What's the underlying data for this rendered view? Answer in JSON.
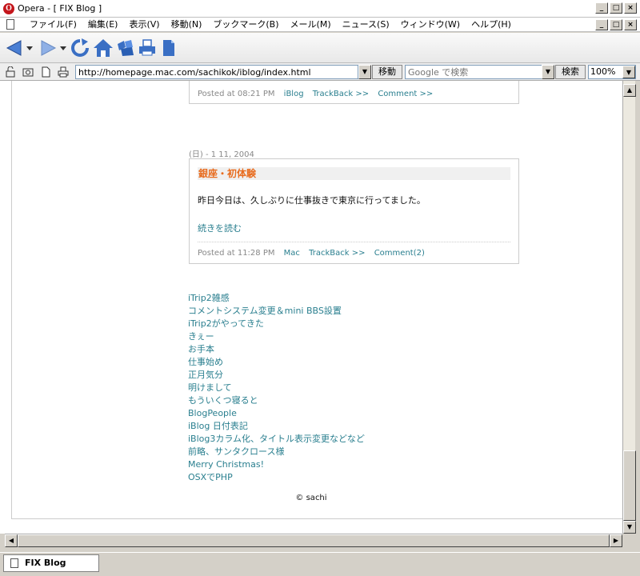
{
  "window": {
    "title": "Opera - [ FIX Blog ]",
    "controls": [
      "_",
      "□",
      "×"
    ]
  },
  "menubar": {
    "items": [
      "ファイル(F)",
      "編集(E)",
      "表示(V)",
      "移動(N)",
      "ブックマーク(B)",
      "メール(M)",
      "ニュース(S)",
      "ウィンドウ(W)",
      "ヘルプ(H)"
    ]
  },
  "toolbar": {
    "icons": [
      "back-icon",
      "back-dropdown-icon",
      "forward-icon",
      "forward-dropdown-icon",
      "reload-icon",
      "home-icon",
      "hotlist-icon",
      "print-icon",
      "page-icon"
    ]
  },
  "addressbar": {
    "url": "http://homepage.mac.com/sachikok/iblog/index.html",
    "go_label": "移動",
    "search_placeholder": "Google で検索",
    "search_label": "検索",
    "zoom": "100%"
  },
  "prev_post": {
    "posted": "Posted at 08:21 PM",
    "category": "iBlog",
    "trackback": "TrackBack >>",
    "comment": "Comment >>"
  },
  "post": {
    "date": "(日) - 1 11, 2004",
    "title": "銀座・初体験",
    "body": "昨日今日は、久しぶりに仕事抜きで東京に行ってました。",
    "read_more": "続きを読む",
    "posted": "Posted at 11:28 PM",
    "category": "Mac",
    "trackback": "TrackBack >>",
    "comment": "Comment(2)"
  },
  "recent_entries": [
    "iTrip2雑感",
    "コメントシステム変更＆mini BBS設置",
    "iTrip2がやってきた",
    "きぇー",
    "お手本",
    "仕事始め",
    "正月気分",
    "明けまして",
    "もういくつ寝ると",
    "BlogPeople",
    "iBlog 日付表記",
    "iBlog3カラム化、タイトル表示変更などなど",
    "前略、サンタクロース様",
    "Merry Christmas!",
    "OSXでPHP"
  ],
  "copyright": "© sachi",
  "taskbar": {
    "task": "FIX Blog"
  },
  "colors": {
    "accent_title": "#e86c1f",
    "link": "#2a7f8f"
  }
}
